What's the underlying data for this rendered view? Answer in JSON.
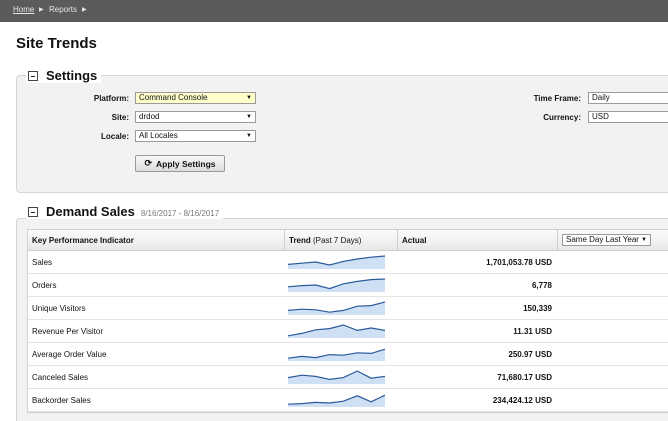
{
  "breadcrumb": {
    "home": "Home",
    "reports": "Reports",
    "sep": "▶"
  },
  "page": {
    "title": "Site Trends"
  },
  "settings": {
    "title": "Settings",
    "platform_label": "Platform:",
    "platform_value": "Command Console",
    "site_label": "Site:",
    "site_value": "drdod",
    "locale_label": "Locale:",
    "locale_value": "All Locales",
    "timeframe_label": "Time Frame:",
    "timeframe_value": "Daily",
    "currency_label": "Currency:",
    "currency_value": "USD",
    "apply_label": "Apply Settings",
    "caret": "▼"
  },
  "demand": {
    "title": "Demand Sales",
    "date_range": "8/16/2017 - 8/16/2017",
    "col_kpi": "Key Performance Indicator",
    "col_trend": "Trend",
    "col_trend_sub": "(Past 7 Days)",
    "col_actual": "Actual",
    "compare_value": "Same Day Last Year",
    "rows": [
      {
        "kpi": "Sales",
        "actual": "1,701,053.78 USD",
        "trend": [
          0.3,
          0.4,
          0.5,
          0.25,
          0.55,
          0.75,
          0.9,
          1.0
        ]
      },
      {
        "kpi": "Orders",
        "actual": "6,778",
        "trend": [
          0.35,
          0.45,
          0.5,
          0.2,
          0.6,
          0.8,
          0.95,
          1.0
        ]
      },
      {
        "kpi": "Unique Visitors",
        "actual": "150,339",
        "trend": [
          0.3,
          0.4,
          0.35,
          0.15,
          0.3,
          0.65,
          0.7,
          1.0
        ]
      },
      {
        "kpi": "Revenue Per Visitor",
        "actual": "11.31 USD",
        "trend": [
          0.1,
          0.3,
          0.6,
          0.7,
          1.0,
          0.55,
          0.75,
          0.55
        ]
      },
      {
        "kpi": "Average Order Value",
        "actual": "250.97 USD",
        "trend": [
          0.15,
          0.3,
          0.2,
          0.45,
          0.4,
          0.6,
          0.55,
          0.9
        ]
      },
      {
        "kpi": "Canceled Sales",
        "actual": "71,680.17 USD",
        "trend": [
          0.45,
          0.65,
          0.55,
          0.3,
          0.45,
          1.0,
          0.4,
          0.55
        ]
      },
      {
        "kpi": "Backorder Sales",
        "actual": "234,424.12 USD",
        "trend": [
          0.15,
          0.2,
          0.3,
          0.25,
          0.4,
          0.85,
          0.35,
          0.9
        ]
      }
    ]
  },
  "colors": {
    "spark_line": "#2a5a9a",
    "spark_fill": "#cfe0f5",
    "topbar": "#5b5b5b",
    "panel": "#f2f2f2"
  }
}
